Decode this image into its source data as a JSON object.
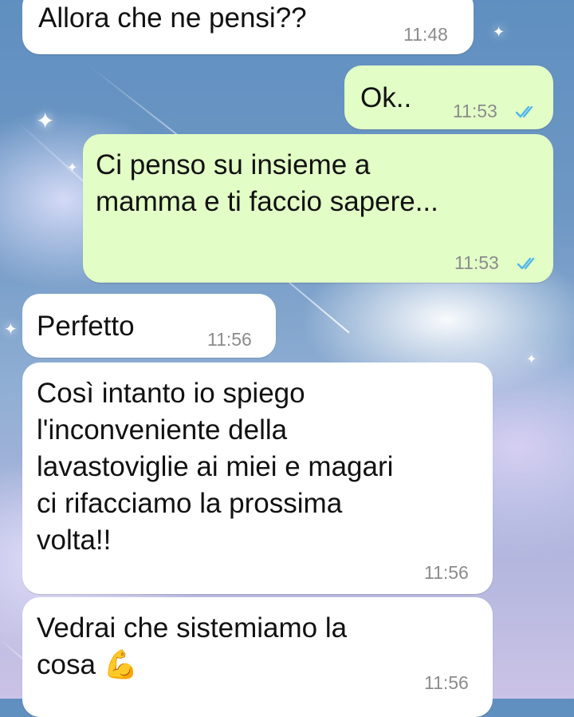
{
  "messages": [
    {
      "direction": "incoming",
      "text": "Allora che ne pensi??",
      "time": "11:48"
    },
    {
      "direction": "outgoing",
      "text": "Ok..",
      "time": "11:53",
      "status": "read-double-check-icon"
    },
    {
      "direction": "outgoing",
      "text": "Ci penso su insieme a\nmamma e ti faccio sapere...",
      "time": "11:53",
      "status": "read-double-check-icon"
    },
    {
      "direction": "incoming",
      "text": "Perfetto",
      "time": "11:56"
    },
    {
      "direction": "incoming",
      "text": "Così intanto io spiego\nl'inconveniente della\nlavastoviglie ai miei e magari\nci rifacciamo la prossima\nvolta!!",
      "time": "11:56"
    },
    {
      "direction": "incoming",
      "text": "Vedrai che sistemiamo la\ncosa",
      "emoji": "💪",
      "time": "11:56"
    }
  ],
  "colors": {
    "incoming_bubble": "#ffffff",
    "outgoing_bubble": "#e2fdc6",
    "read_tick": "#4fb6ec",
    "timestamp": "#8c8c8c"
  }
}
